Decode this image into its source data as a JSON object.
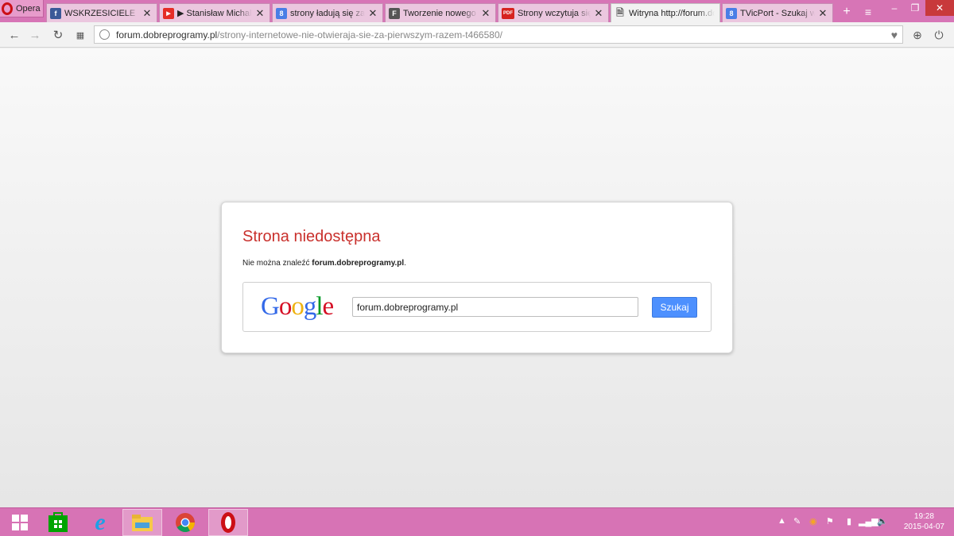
{
  "browser": {
    "menu_label": "Opera",
    "tabs": [
      {
        "title": "WSKRZESICIELE",
        "icon": "facebook-icon",
        "fav_text": "f",
        "fav_color": "#3b5998"
      },
      {
        "title": "▶ Stanisław Michalkiewicz",
        "icon": "youtube-icon",
        "fav_text": "▶",
        "fav_color": "#e52d27"
      },
      {
        "title": "strony ładują się za drugim razem",
        "icon": "google-icon",
        "fav_text": "8",
        "fav_color": "#4a7ee6"
      },
      {
        "title": "Tworzenie nowego tematu",
        "icon": "forum-icon",
        "fav_text": "F",
        "fav_color": "#555555"
      },
      {
        "title": "Strony wczytuja się za drugim",
        "icon": "pdf-icon",
        "fav_text": "PDF",
        "fav_color": "#d6231f"
      },
      {
        "title": "Witryna http://forum.dobreprogramy.pl",
        "icon": "page-icon",
        "fav_text": "",
        "fav_color": "#777777"
      },
      {
        "title": "TVicPort - Szukaj w Google",
        "icon": "google-icon",
        "fav_text": "8",
        "fav_color": "#4a7ee6"
      }
    ],
    "url_host": "forum.dobreprogramy.pl",
    "url_path": "/strony-internetowe-nie-otwieraja-sie-za-pierwszym-razem-t466580/"
  },
  "error_page": {
    "title": "Strona niedostępna",
    "message_prefix": "Nie można znaleźć ",
    "message_host": "forum.dobreprogramy.pl",
    "message_suffix": ".",
    "search_logo": "Google",
    "search_value": "forum.dobreprogramy.pl",
    "search_button": "Szukaj"
  },
  "taskbar": {
    "apps": [
      "windows-start-icon",
      "store-icon",
      "internet-explorer-icon",
      "file-explorer-icon",
      "chrome-icon",
      "opera-icon"
    ],
    "clock_time": "19:28",
    "clock_date": "2015-04-07"
  },
  "colors": {
    "accent": "#d775b6",
    "error_title": "#c9302c",
    "search_button": "#4d90fe"
  }
}
